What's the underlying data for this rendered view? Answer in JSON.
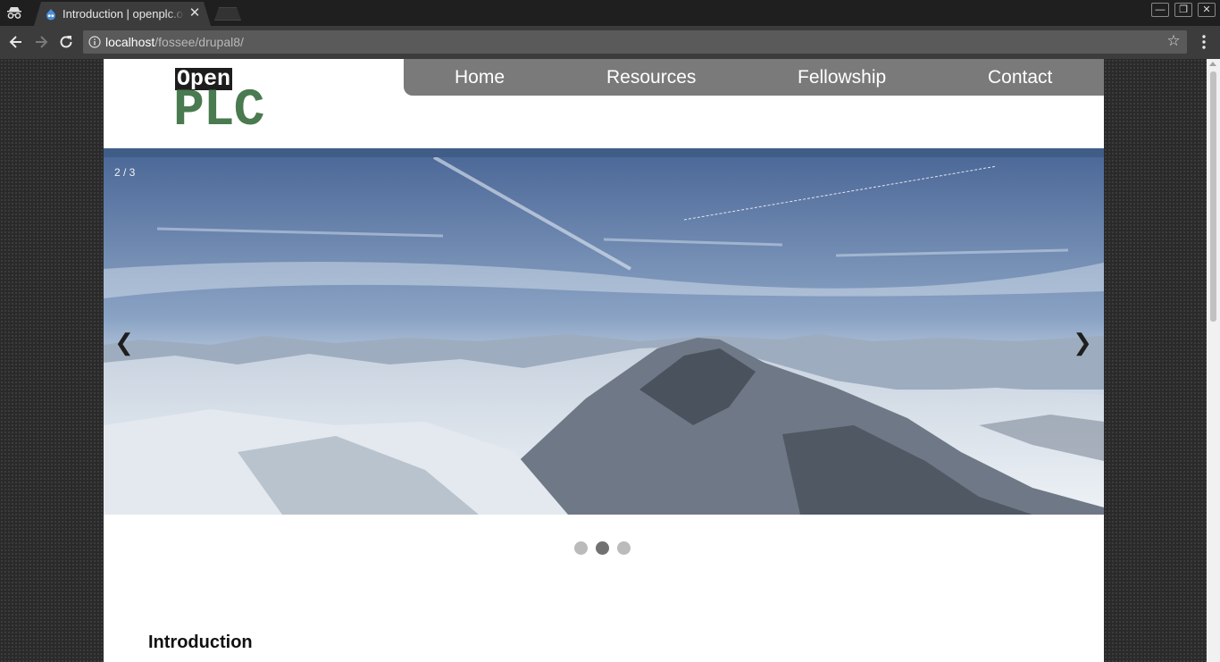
{
  "browser": {
    "tab_title": "Introduction | openplc.org",
    "tab_close": "✕",
    "url_host": "localhost",
    "url_path": "/fossee/drupal8/",
    "win_minimize": "—",
    "win_restore": "❐",
    "win_close": "✕",
    "star": "☆"
  },
  "site": {
    "logo_top": "Open",
    "logo_bottom": "PLC",
    "nav": [
      "Home",
      "Resources",
      "Fellowship",
      "Contact"
    ]
  },
  "slider": {
    "counter": "2 / 3",
    "prev_arrow": "❮",
    "next_arrow": "❯",
    "slide_count": 3,
    "active_index": 1
  },
  "content": {
    "heading": "Introduction"
  },
  "colors": {
    "nav_bg": "#7a7a7a",
    "logo_green": "#4a7a50",
    "dot_active": "#717171",
    "dot_inactive": "#bbbbbb",
    "slider_band": "#405d87"
  }
}
